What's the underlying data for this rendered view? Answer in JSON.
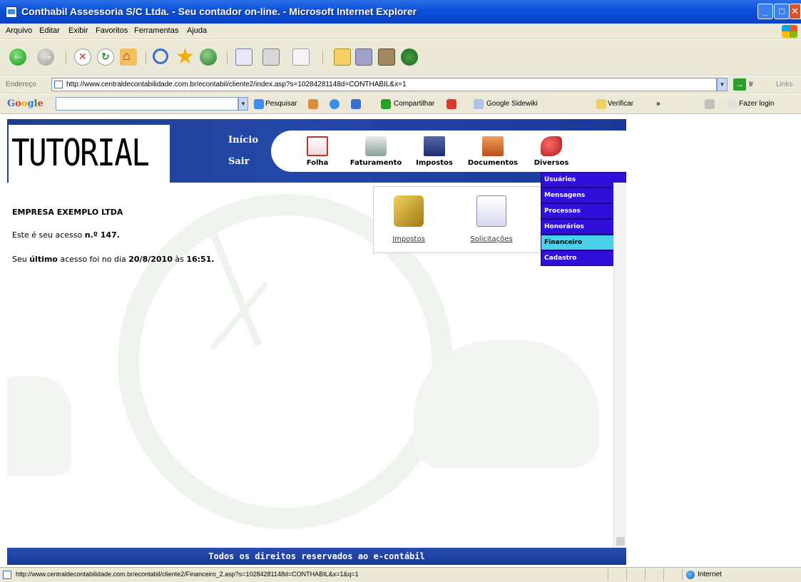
{
  "window": {
    "title": "Conthabil Assessoria S/C Ltda. - Seu contador on-line. - Microsoft Internet Explorer"
  },
  "menubar": {
    "items": [
      "Arquivo",
      "Editar",
      "Exibir",
      "Favoritos",
      "Ferramentas",
      "Ajuda"
    ]
  },
  "addressbar": {
    "label": "Endereço",
    "url": "http://www.centraldecontabilidade.com.br/econtabil/cliente2/index.asp?s=10284281148d=CONTHABIL&x=1",
    "go_label": "Ir",
    "links_label": "Links"
  },
  "googlebar": {
    "logo": "Google",
    "search": "Pesquisar",
    "share": "Compartilhar",
    "sidewiki": "Google Sidewiki",
    "check": "Verificar",
    "more": "»",
    "login": "Fazer login"
  },
  "site": {
    "logo_text": "TUTORIAL",
    "nav_links": {
      "inicio": "Início",
      "sair": "Sair"
    },
    "modules": [
      {
        "label": "Folha",
        "icon": "payroll-icon"
      },
      {
        "label": "Faturamento",
        "icon": "billing-icon"
      },
      {
        "label": "Impostos",
        "icon": "taxes-icon"
      },
      {
        "label": "Documentos",
        "icon": "documents-icon"
      },
      {
        "label": "Diversos",
        "icon": "misc-icon"
      }
    ],
    "diversos_menu": [
      "Usuários",
      "Mensagens",
      "Processos",
      "Honorários",
      "Financeiro",
      "Cadastro"
    ],
    "diversos_highlighted": "Financeiro",
    "quick_icons": [
      {
        "label": "Impostos",
        "icon": "tax-folder-icon"
      },
      {
        "label": "Solicitações",
        "icon": "info-document-icon"
      }
    ],
    "company": "EMPRESA EXEMPLO LTDA",
    "access_prefix": "Este é seu acesso ",
    "access_count": "n.º 147.",
    "last_prefix": "Seu ",
    "last_word": "último",
    "last_mid": " acesso foi no dia ",
    "last_date": "20/8/2010",
    "last_at": " às ",
    "last_time": "16:51.",
    "footer": "Todos os direitos reservados ao e-contábil"
  },
  "statusbar": {
    "url": "http://www.centraldecontabilidade.com.br/econtabil/cliente2/Financeiro_2.asp?s=10284281148d=CONTHABIL&x=1&q=1",
    "zone": "Internet"
  }
}
